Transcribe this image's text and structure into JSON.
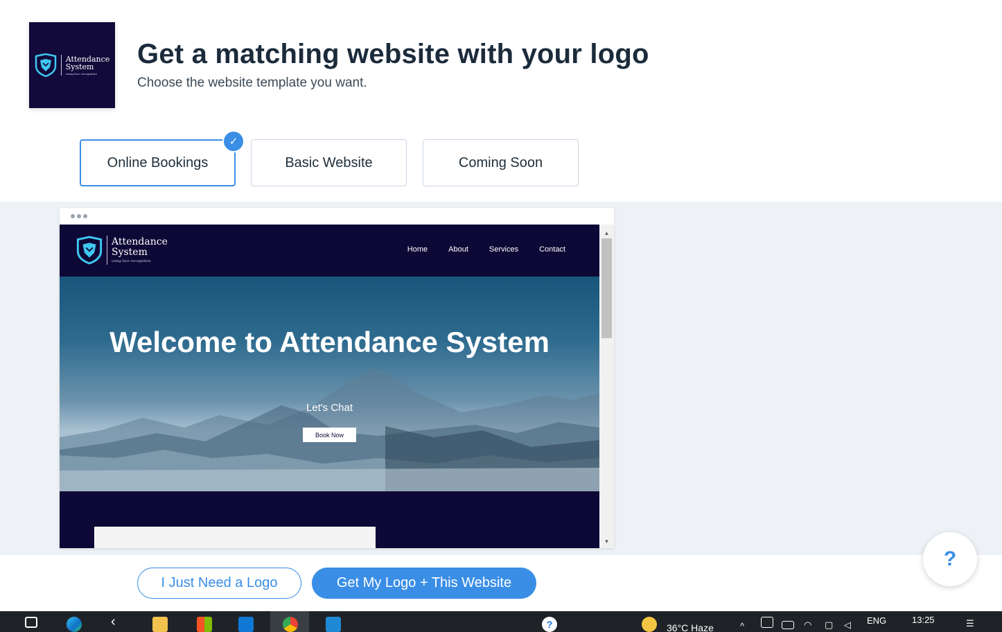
{
  "header": {
    "logo": {
      "name_line1": "Attendance",
      "name_line2": "System",
      "tagline": "using face recognition"
    },
    "title": "Get a matching website with your logo",
    "subtitle": "Choose the website template you want."
  },
  "templates": {
    "tabs": [
      {
        "label": "Online Bookings",
        "selected": true
      },
      {
        "label": "Basic Website",
        "selected": false
      },
      {
        "label": "Coming Soon",
        "selected": false
      }
    ]
  },
  "preview": {
    "site_name_line1": "Attendance",
    "site_name_line2": "System",
    "site_tagline": "using face recognition",
    "nav": [
      "Home",
      "About",
      "Services",
      "Contact"
    ],
    "hero_title": "Welcome to Attendance System",
    "hero_subtitle": "Let's Chat",
    "hero_button": "Book Now"
  },
  "actions": {
    "logo_only": "I Just Need a Logo",
    "logo_and_website": "Get My Logo + This Website",
    "help": "?"
  },
  "taskbar": {
    "weather": "36°C  Haze",
    "language": "ENG",
    "time": "13:25"
  },
  "colors": {
    "accent": "#3a8ee6",
    "brand_navy": "#0e0836",
    "brand_teal": "#3fc8f0"
  }
}
